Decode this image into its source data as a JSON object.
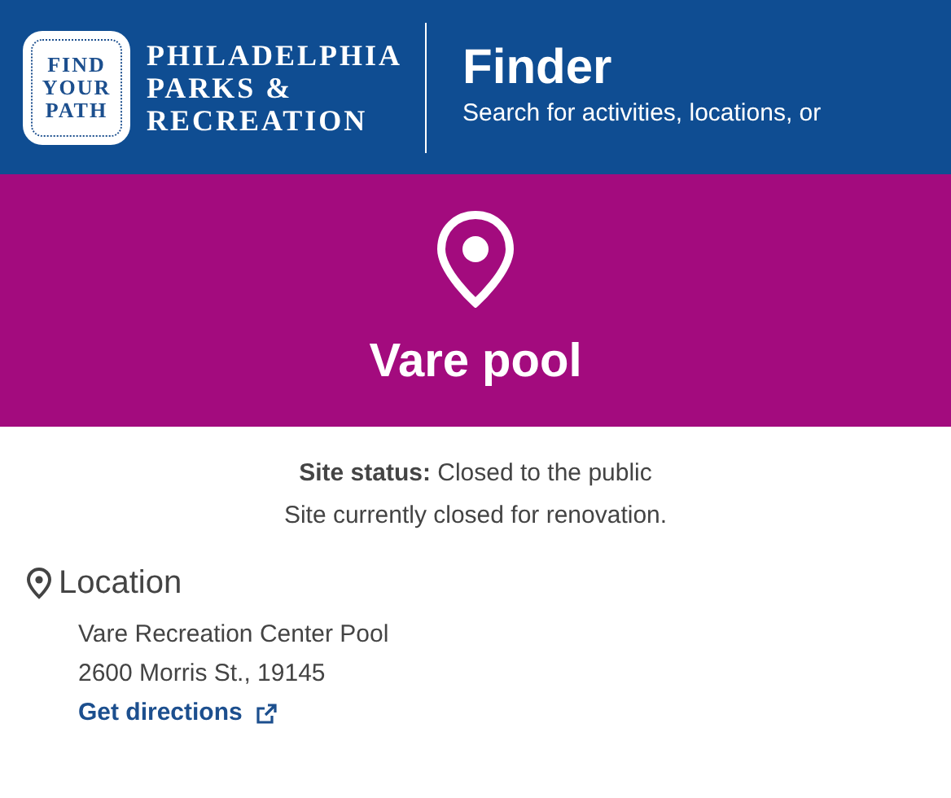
{
  "header": {
    "badge_lines": [
      "FIND",
      "YOUR",
      "PATH"
    ],
    "org_lines": [
      "PHILADELPHIA",
      "PARKS &",
      "RECREATION"
    ],
    "title": "Finder",
    "subtitle": "Search for activities, locations, or"
  },
  "banner": {
    "title": "Vare pool"
  },
  "status": {
    "text": "**Site status:** Closed to the public",
    "note": "Site currently closed for renovation."
  },
  "location": {
    "heading": "Location",
    "lines": [
      "Vare Recreation Center Pool",
      "2600 Morris St., 19145"
    ],
    "link": "Get directions"
  }
}
